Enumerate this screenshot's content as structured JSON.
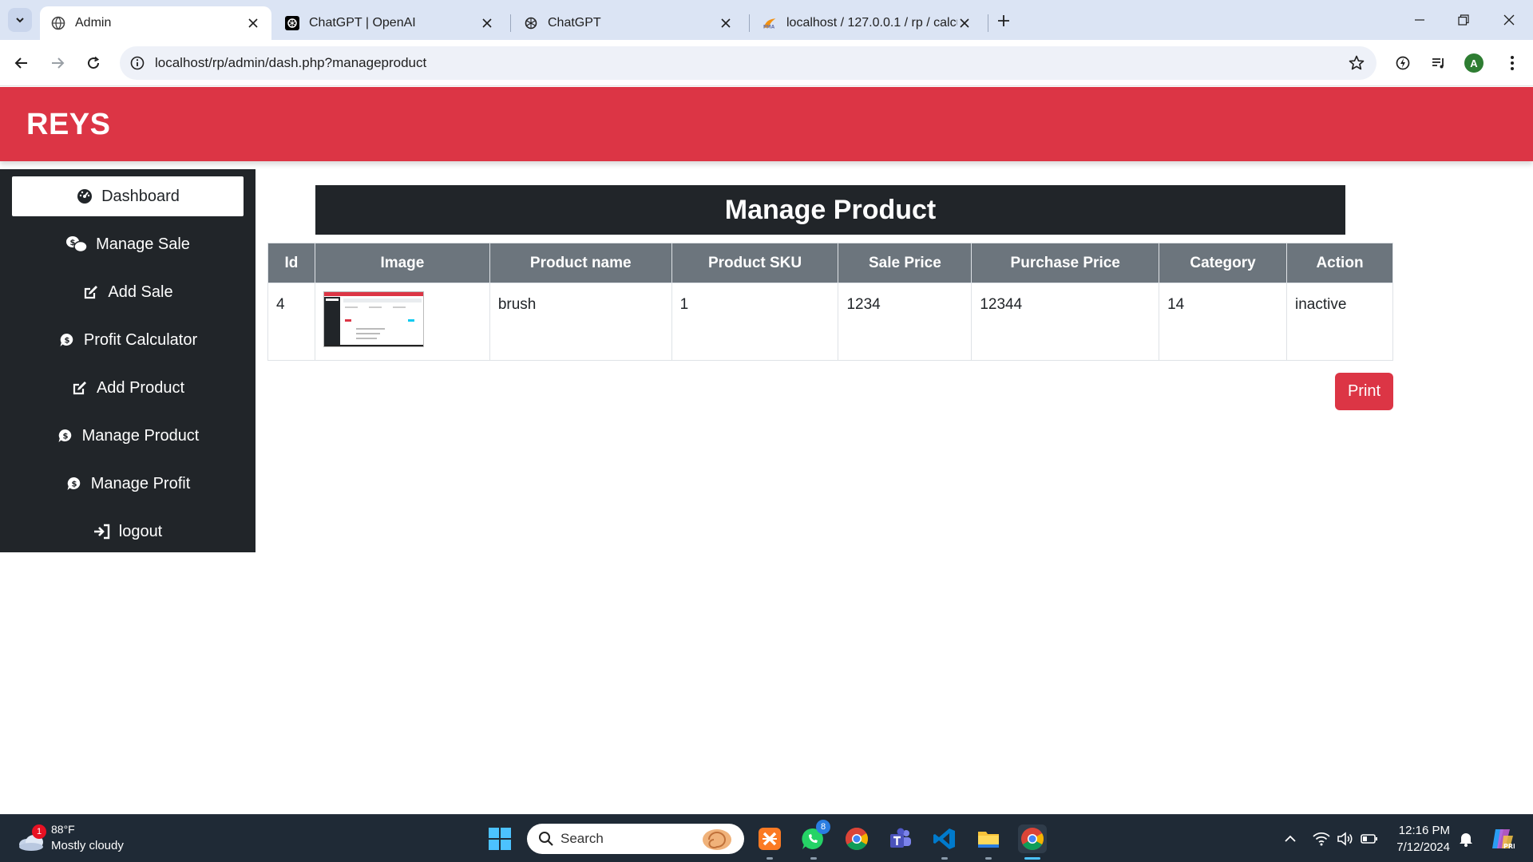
{
  "browser": {
    "tabs": [
      {
        "title": "Admin",
        "active": true
      },
      {
        "title": "ChatGPT | OpenAI",
        "active": false
      },
      {
        "title": "ChatGPT",
        "active": false
      },
      {
        "title": "localhost / 127.0.0.1 / rp / calcu",
        "active": false
      }
    ],
    "url": "localhost/rp/admin/dash.php?manageproduct",
    "profile_initial": "A"
  },
  "page": {
    "brand": "REYS",
    "sidebar": [
      {
        "label": "Dashboard",
        "icon": "dashboard-icon",
        "active": true
      },
      {
        "label": "Manage Sale",
        "icon": "coins-icon",
        "active": false
      },
      {
        "label": "Add Sale",
        "icon": "edit-icon",
        "active": false
      },
      {
        "label": "Profit Calculator",
        "icon": "dollar-chat-icon",
        "active": false
      },
      {
        "label": "Add Product",
        "icon": "edit-icon",
        "active": false
      },
      {
        "label": "Manage Product",
        "icon": "dollar-chat-icon",
        "active": false
      },
      {
        "label": "Manage Profit",
        "icon": "dollar-chat-icon",
        "active": false
      },
      {
        "label": "logout",
        "icon": "sign-in-icon",
        "active": false
      }
    ],
    "title": "Manage Product",
    "table": {
      "headers": [
        "Id",
        "Image",
        "Product name",
        "Product SKU",
        "Sale Price",
        "Purchase Price",
        "Category",
        "Action"
      ],
      "rows": [
        {
          "id": "4",
          "name": "brush",
          "sku": "1",
          "sale_price": "1234",
          "purchase_price": "12344",
          "category": "14",
          "action": "inactive"
        }
      ]
    },
    "print_label": "Print",
    "accent_color": "#dc3545",
    "dark_color": "#212529"
  },
  "taskbar": {
    "weather_badge": "1",
    "temperature": "88°F",
    "condition": "Mostly cloudy",
    "search_placeholder": "Search",
    "whatsapp_badge": "8",
    "time": "12:16 PM",
    "date": "7/12/2024"
  }
}
